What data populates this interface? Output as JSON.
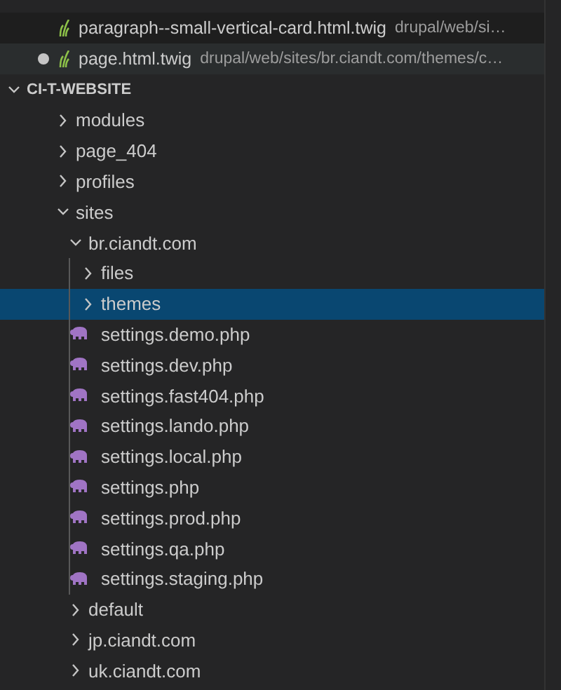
{
  "open_editors": [
    {
      "name": "paragraph--small-vertical-card.html.twig",
      "path": "drupal/web/si…",
      "dirty": false,
      "selected": false
    },
    {
      "name": "page.html.twig",
      "path": "drupal/web/sites/br.ciandt.com/themes/c…",
      "dirty": true,
      "selected": true
    }
  ],
  "section": {
    "title": "CI-T-WEBSITE",
    "expanded": true
  },
  "tree": [
    {
      "name": "modules",
      "kind": "folder",
      "expanded": false,
      "selected": false
    },
    {
      "name": "page_404",
      "kind": "folder",
      "expanded": false,
      "selected": false
    },
    {
      "name": "profiles",
      "kind": "folder",
      "expanded": false,
      "selected": false
    },
    {
      "name": "sites",
      "kind": "folder",
      "expanded": true,
      "selected": false,
      "children": [
        {
          "name": "br.ciandt.com",
          "kind": "folder",
          "expanded": true,
          "selected": false,
          "children": [
            {
              "name": "files",
              "kind": "folder",
              "expanded": false,
              "selected": false
            },
            {
              "name": "themes",
              "kind": "folder",
              "expanded": false,
              "selected": true
            },
            {
              "name": "settings.demo.php",
              "kind": "php",
              "selected": false
            },
            {
              "name": "settings.dev.php",
              "kind": "php",
              "selected": false
            },
            {
              "name": "settings.fast404.php",
              "kind": "php",
              "selected": false
            },
            {
              "name": "settings.lando.php",
              "kind": "php",
              "selected": false
            },
            {
              "name": "settings.local.php",
              "kind": "php",
              "selected": false
            },
            {
              "name": "settings.php",
              "kind": "php",
              "selected": false
            },
            {
              "name": "settings.prod.php",
              "kind": "php",
              "selected": false
            },
            {
              "name": "settings.qa.php",
              "kind": "php",
              "selected": false
            },
            {
              "name": "settings.staging.php",
              "kind": "php",
              "selected": false
            }
          ]
        },
        {
          "name": "default",
          "kind": "folder",
          "expanded": false,
          "selected": false
        },
        {
          "name": "jp.ciandt.com",
          "kind": "folder",
          "expanded": false,
          "selected": false
        },
        {
          "name": "uk.ciandt.com",
          "kind": "folder",
          "expanded": false,
          "selected": false
        }
      ]
    }
  ]
}
